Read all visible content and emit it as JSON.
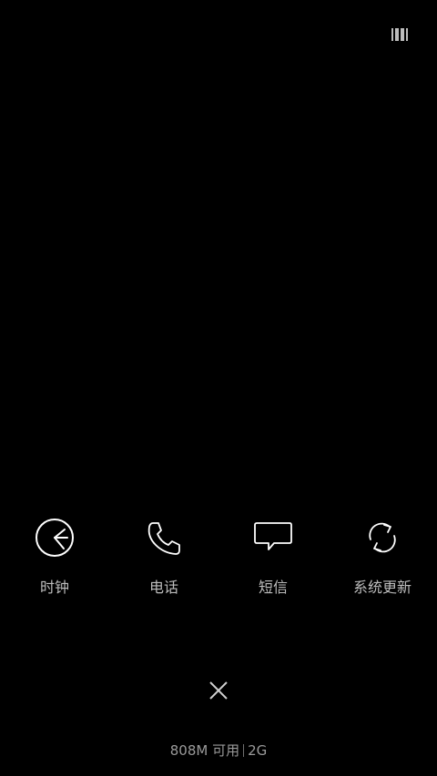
{
  "top_right": {
    "icon": "multiwindow-icon"
  },
  "apps": [
    {
      "label": "时钟",
      "icon": "clock-icon"
    },
    {
      "label": "电话",
      "icon": "phone-icon"
    },
    {
      "label": "短信",
      "icon": "message-icon"
    },
    {
      "label": "系统更新",
      "icon": "system-update-icon"
    }
  ],
  "close": {
    "icon": "close-icon"
  },
  "memory": {
    "available": "808M 可用",
    "total": "2G"
  },
  "colors": {
    "background": "#000000",
    "text": "#bdbdbd"
  }
}
